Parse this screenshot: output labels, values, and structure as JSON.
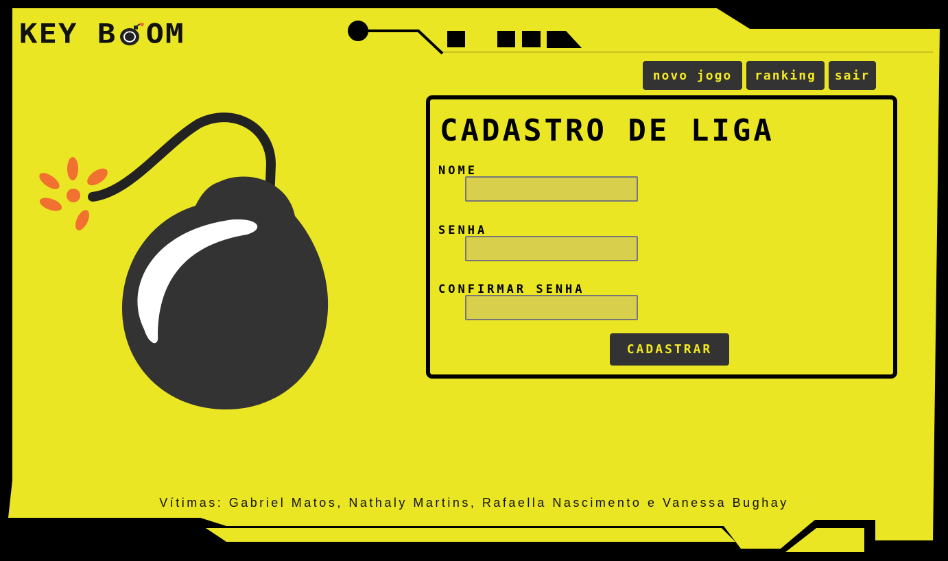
{
  "app": {
    "logo_text_left": "KEY B",
    "logo_text_right": "OM"
  },
  "nav": {
    "new_game": "novo jogo",
    "ranking": "ranking",
    "logout": "sair"
  },
  "form": {
    "title": "Cadastro de Liga",
    "name_label": "Nome",
    "name_value": "",
    "password_label": "Senha",
    "password_value": "",
    "confirm_label": "Confirmar Senha",
    "confirm_value": "",
    "submit_label": "Cadastrar"
  },
  "footer": {
    "text": "Vítimas: Gabriel Matos, Nathaly Martins, Rafaella Nascimento e Vanessa Bughay"
  },
  "colors": {
    "background": "#eae624",
    "frame": "#000000",
    "button": "#333333",
    "button_text": "#f3ea22",
    "input": "#d8d04c",
    "spark": "#f07130"
  },
  "icons": {
    "logo_bomb": "bomb-icon",
    "hero": "bomb-illustration"
  }
}
